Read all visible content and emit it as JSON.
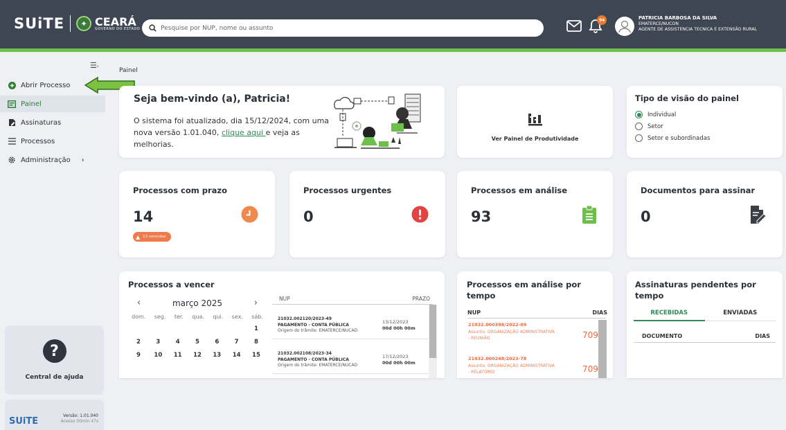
{
  "header": {
    "brand": "SUiTE",
    "state_name": "CEARÁ",
    "state_sub": "GOVERNO DO ESTADO",
    "search_placeholder": "Pesquise por NUP, nome ou assunto",
    "notification_count": "94",
    "user_name": "PATRICIA BARBOSA DA SILVA",
    "user_unit": "EMATERCE/NUCON",
    "user_role": "AGENTE DE ASSISTENCIA TECNICA E EXTENSÃO RURAL",
    "colors": {
      "bar": "#3f4653",
      "accent": "#6cc04a",
      "badge": "#e8792f"
    }
  },
  "sidebar": {
    "items": [
      {
        "label": "Abrir Processo",
        "icon": "plus-circle-icon"
      },
      {
        "label": "Painel",
        "icon": "dashboard-icon"
      },
      {
        "label": "Assinaturas",
        "icon": "signature-icon"
      },
      {
        "label": "Processos",
        "icon": "list-icon"
      },
      {
        "label": "Administração",
        "icon": "gear-icon"
      }
    ],
    "help_label": "Central de ajuda",
    "brand": "SUiTE",
    "version": "Versão: 1.01.040",
    "access": "Acesso 00min 47s"
  },
  "breadcrumb": "Painel",
  "welcome": {
    "title": "Seja bem-vindo (a), Patricia!",
    "text_before": "O sistema foi atualizado, dia 15/12/2024, com uma nova versão 1.01.040, ",
    "link": "clique aqui ",
    "text_after": "e veja as melhorias."
  },
  "productivity": {
    "label": "Ver Painel de Produtividade"
  },
  "view_type": {
    "title": "Tipo de visão do painel",
    "options": [
      "Individual",
      "Setor",
      "Setor e subordinadas"
    ],
    "selected": "Individual"
  },
  "stats": [
    {
      "title": "Processos com prazo",
      "value": "14",
      "badge": "13 vencidos",
      "color": "#ef8a4e"
    },
    {
      "title": "Processos urgentes",
      "value": "0",
      "color": "#e04444"
    },
    {
      "title": "Processos em análise",
      "value": "93",
      "color": "#6cc04a"
    },
    {
      "title": "Documentos para assinar",
      "value": "0",
      "color": "#3a3f47"
    }
  ],
  "due": {
    "title": "Processos a vencer",
    "month": "março 2025",
    "weekdays": [
      "dom.",
      "seg.",
      "ter.",
      "qua.",
      "qui.",
      "sex.",
      "sáb."
    ],
    "weeks": [
      [
        "",
        "",
        "",
        "",
        "",
        "",
        "1"
      ],
      [
        "2",
        "3",
        "4",
        "5",
        "6",
        "7",
        "8"
      ],
      [
        "9",
        "10",
        "11",
        "12",
        "13",
        "14",
        "15"
      ]
    ],
    "table_headers": [
      "NUP",
      "PRAZO"
    ],
    "rows": [
      {
        "nup": "21032.002120/2023-49",
        "subject": "PAGAMENTO - CONTA PÚBLICA",
        "origin": "Origem do trâmite: EMATERCE/NUCAD",
        "date": "13/12/2023",
        "time": "00d 00h 00m"
      },
      {
        "nup": "21032.002108/2023-34",
        "subject": "PAGAMENTO - CONTA PÚBLICA",
        "origin": "Origem do trâmite: EMATERCE/NUCAD",
        "date": "17/12/2023",
        "time": "00d 00h 00m"
      }
    ]
  },
  "analysis": {
    "title": "Processos em análise por tempo",
    "headers": [
      "NUP",
      "DIAS"
    ],
    "rows": [
      {
        "nup": "21032.000398/2022-09",
        "subject": "Assunto: ORGANIZAÇÃO ADMINISTRATIVA",
        "sub2": "- REUNIÃO",
        "days": "709"
      },
      {
        "nup": "21032.000248/2023-78",
        "subject": "Assunto: ORGANIZAÇÃO ADMINISTRATIVA",
        "sub2": "- RELATÓRIO",
        "days": "709"
      }
    ]
  },
  "signatures": {
    "title": "Assinaturas pendentes por tempo",
    "tabs": [
      "RECEBIDAS",
      "ENVIADAS"
    ],
    "headers": [
      "DOCUMENTO",
      "DIAS"
    ]
  }
}
